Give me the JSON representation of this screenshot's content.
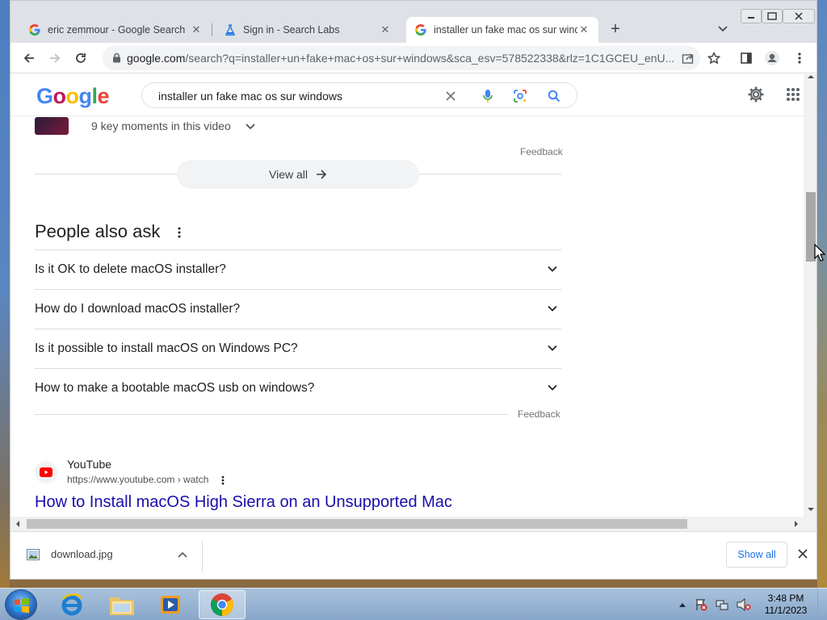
{
  "tabs": [
    {
      "title": "eric zemmour - Google Search",
      "favicon": "google-g-icon",
      "active": false
    },
    {
      "title": "Sign in - Search Labs",
      "favicon": "labs-flask-icon",
      "active": false
    },
    {
      "title": "installer un fake mac os sur windows",
      "favicon": "google-g-icon",
      "active": true
    }
  ],
  "omnibox": {
    "host": "google.com",
    "path": "/search?q=installer+un+fake+mac+os+sur+windows&sca_esv=578522338&rlz=1C1GCEU_enU..."
  },
  "search": {
    "logo": "Google",
    "query": "installer un fake mac os sur windows"
  },
  "results": {
    "key_moments": "9 key moments in this video",
    "feedback": "Feedback",
    "view_all": "View all",
    "paa_title": "People also ask",
    "paa_questions": [
      "Is it OK to delete macOS installer?",
      "How do I download macOS installer?",
      "Is it possible to install macOS on Windows PC?",
      "How to make a bootable macOS usb on windows?"
    ],
    "feedback2": "Feedback",
    "youtube": {
      "site": "YouTube",
      "url": "https://www.youtube.com › watch",
      "title": "How to Install macOS High Sierra on an Unsupported Mac"
    }
  },
  "downloads": {
    "file": "download.jpg",
    "show_all": "Show all"
  },
  "taskbar": {
    "time": "3:48 PM",
    "date": "11/1/2023"
  },
  "colors": {
    "link": "#1a0dab",
    "accent": "#1a73e8"
  }
}
